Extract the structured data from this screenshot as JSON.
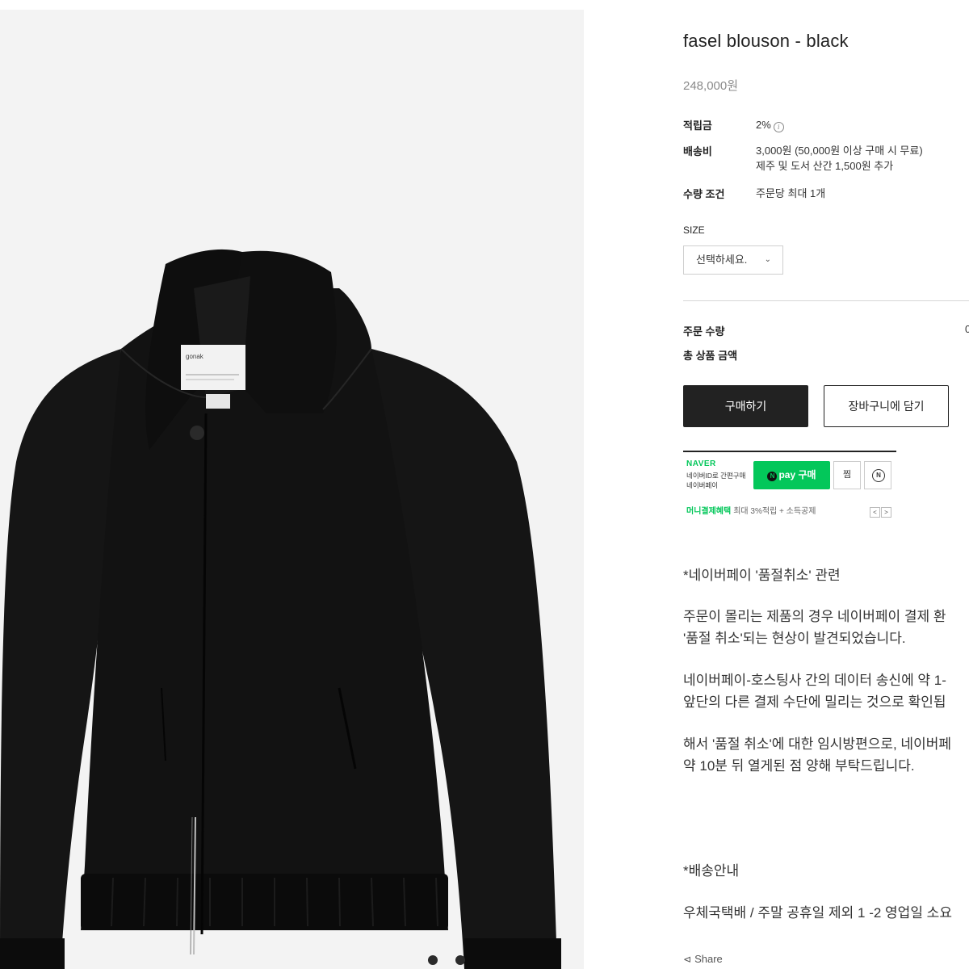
{
  "product": {
    "title": "fasel blouson - black",
    "price": "248,000원",
    "image_alt": "black blouson jacket",
    "garment_tag": "gonak"
  },
  "specs": [
    {
      "label": "적립금",
      "value": "2%"
    },
    {
      "label": "배송비",
      "value": "3,000원 (50,000원 이상 구매 시 무료)",
      "value2": "제주 및 도서 산간 1,500원 추가"
    },
    {
      "label": "수량 조건",
      "value": "주문당 최대 1개"
    }
  ],
  "size": {
    "label": "SIZE",
    "selected": "선택하세요."
  },
  "order": {
    "qty_label": "주문 수량",
    "qty_value_edge": "0",
    "total_label": "총 상품 금액"
  },
  "buttons": {
    "buy": "구매하기",
    "cart": "장바구니에 담기"
  },
  "naverpay": {
    "brand": "NAVER",
    "desc_line1": "네이버ID로 간편구매",
    "desc_line2": "네이버페이",
    "pay_label": "pay 구매",
    "pay_n": "N",
    "wish_label": "찜",
    "n_label": "N",
    "benefit_green": "머니결제혜택",
    "benefit_gray": "최대 3%적립 + 소득공제",
    "prev": "<",
    "next": ">"
  },
  "notice": {
    "heading": "*네이버페이 '품절취소' 관련",
    "p1_l1": "주문이 몰리는 제품의 경우 네이버페이 결제 환",
    "p1_l2": "'품절 취소'되는 현상이 발견되었습니다.",
    "p2_l1": "네이버페이-호스팅사 간의 데이터 송신에 약 1-",
    "p2_l2": "앞단의 다른 결제 수단에 밀리는 것으로 확인됩",
    "p3_l1": "해서 '품절 취소'에 대한 임시방편으로, 네이버페",
    "p3_l2": "약 10분 뒤 열게된 점 양해 부탁드립니다.",
    "shipping_heading": "*배송안내",
    "shipping_text": "우체국택배 / 주말 공휴일 제외 1 -2 영업일 소요"
  },
  "share": {
    "label": "Share"
  },
  "colors": {
    "accent_green": "#03c75a",
    "buy_bg": "#222222",
    "image_bg": "#f3f3f3",
    "jacket": "#141414"
  }
}
